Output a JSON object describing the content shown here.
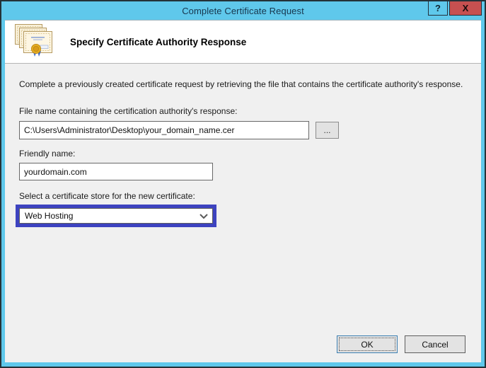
{
  "window": {
    "title": "Complete Certificate Request",
    "help_label": "?",
    "close_label": "X"
  },
  "header": {
    "title": "Specify Certificate Authority Response",
    "icon": "certificates-stack-icon"
  },
  "body": {
    "intro": "Complete a previously created certificate request by retrieving the file that contains the certificate authority's response.",
    "file_field": {
      "label": "File name containing the certification authority's response:",
      "value": "C:\\Users\\Administrator\\Desktop\\your_domain_name.cer",
      "browse_label": "..."
    },
    "friendly_field": {
      "label": "Friendly name:",
      "value": "yourdomain.com"
    },
    "store_field": {
      "label": "Select a certificate store for the new certificate:",
      "value": "Web Hosting",
      "chevron": "chevron-down-icon"
    }
  },
  "footer": {
    "ok_label": "OK",
    "cancel_label": "Cancel"
  },
  "colors": {
    "titlebar_bg": "#5fc8eb",
    "window_border": "#243238",
    "close_button_bg": "#c75050",
    "header_bg": "#ffffff",
    "body_bg": "#f0f0f0",
    "combo_focus_ring": "#3d43c0",
    "ok_button_border": "#3c7fb1"
  }
}
